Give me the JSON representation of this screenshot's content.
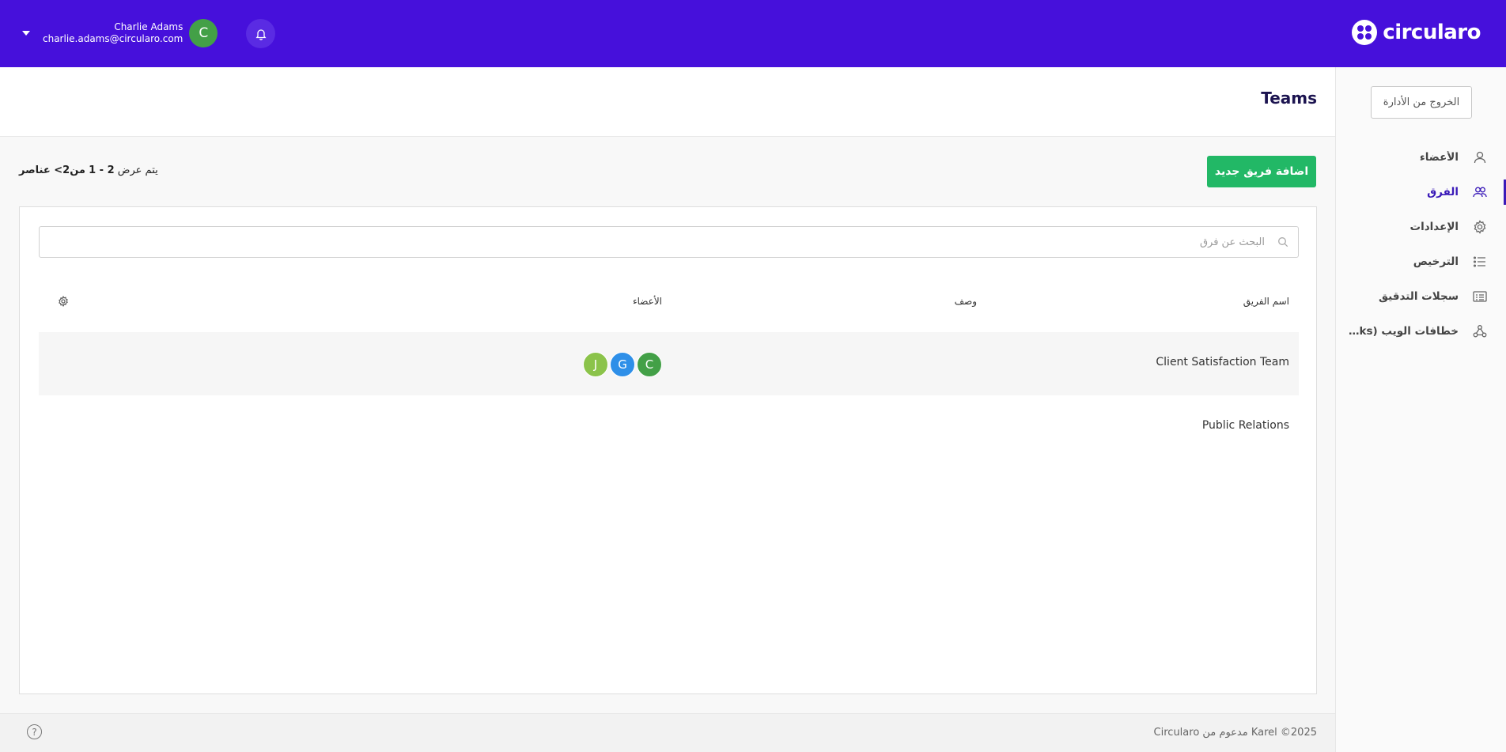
{
  "brand": {
    "name": "circularo"
  },
  "user": {
    "name": "Charlie Adams",
    "email": "charlie.adams@circularo.com",
    "initial": "C"
  },
  "sidebar": {
    "exit_label": "الخروج من الأدارة",
    "items": [
      {
        "label": "الأعضاء",
        "icon": "user-icon"
      },
      {
        "label": "الفرق",
        "icon": "users-icon",
        "active": true
      },
      {
        "label": "الإعدادات",
        "icon": "gear-icon"
      },
      {
        "label": "الترخيص",
        "icon": "list-icon"
      },
      {
        "label": "سجلات التدقيق",
        "icon": "log-icon"
      },
      {
        "label": "خطافات الويب (Webhooks)",
        "icon": "webhook-icon"
      }
    ]
  },
  "header": {
    "title": "Teams"
  },
  "toolbar": {
    "add_label": "اضافة فريق جديد",
    "count_prefix": "يتم عرض",
    "count_range": "2 - 1",
    "count_of": "من",
    "count_total": "2",
    "count_suffix": "> عناصر"
  },
  "search": {
    "placeholder": "البحث عن فرق",
    "value": ""
  },
  "table": {
    "headers": {
      "name": "اسم الفريق",
      "description": "وصف",
      "members": "الأعضاء"
    },
    "rows": [
      {
        "name": "Client Satisfaction Team",
        "members": [
          {
            "initial": "C",
            "color": "#43a047"
          },
          {
            "initial": "G",
            "color": "#2e8fe8"
          },
          {
            "initial": "J",
            "color": "#8bc34a"
          }
        ]
      },
      {
        "name": "Public Relations",
        "members": []
      }
    ]
  },
  "footer": {
    "text": "Circularo مدعوم من Karel ©2025",
    "help": "?"
  },
  "colors": {
    "topbar": "#4610db",
    "accent": "#3a1ab8",
    "add_button": "#22b866"
  }
}
